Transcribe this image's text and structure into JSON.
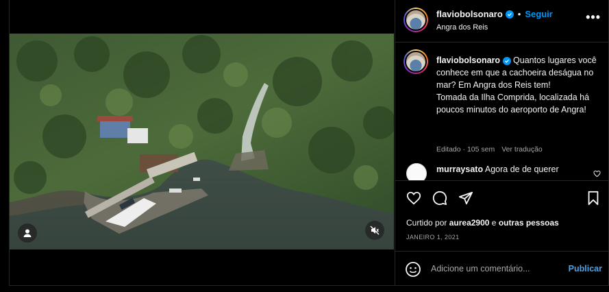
{
  "post": {
    "username": "flaviobolsonaro",
    "follow_label": "Seguir",
    "separator": "•",
    "location": "Angra dos Reis",
    "more_label": "•••"
  },
  "caption": {
    "username": "flaviobolsonaro",
    "text": "Quantos lugares você conhece em que a cachoeira deságua no mar? Em Angra dos Reis tem!\nTomada da Ilha Comprida, localizada há poucos minutos do aeroporto de Angra!",
    "edited_label": "Editado · 105 sem",
    "translate_label": "Ver tradução"
  },
  "comment": {
    "username": "murraysato",
    "text": "Agora de de querer"
  },
  "likes": {
    "prefix": "Curtido por",
    "user": "aurea2900",
    "connector": "e",
    "others": "outras pessoas"
  },
  "date": "JANEIRO 1, 2021",
  "add_comment": {
    "placeholder": "Adicione um comentário...",
    "publish_label": "Publicar"
  },
  "colors": {
    "accent_blue": "#0095f6",
    "border": "#262626",
    "muted_text": "#a8a8a8"
  },
  "icons": [
    "more-icon",
    "verified-icon",
    "heart-icon",
    "comment-icon",
    "share-icon",
    "bookmark-icon",
    "user-tag-icon",
    "muted-icon",
    "emoji-icon"
  ]
}
